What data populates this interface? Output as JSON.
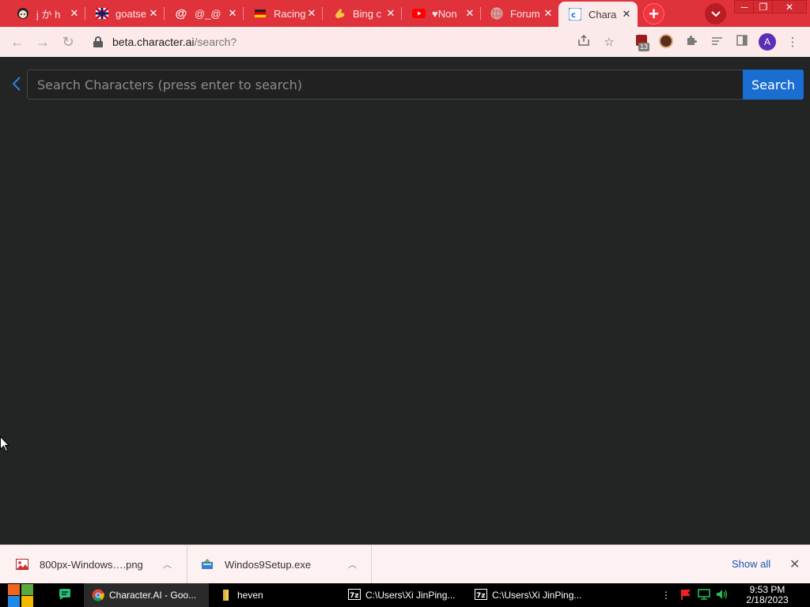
{
  "browser": {
    "tabs": [
      {
        "title": "j か h",
        "icon": "anime-avatar-icon"
      },
      {
        "title": "goatse",
        "icon": "flag-icon"
      },
      {
        "title": "@_@",
        "icon": "at-sign-icon"
      },
      {
        "title": "Racing",
        "icon": "flag-icon"
      },
      {
        "title": "Bing c",
        "icon": "hand-icon"
      },
      {
        "title": "♥Non",
        "icon": "youtube-icon"
      },
      {
        "title": "Forum",
        "icon": "globe-icon"
      },
      {
        "title": "Chara",
        "icon": "character-ai-icon",
        "active": true
      }
    ],
    "new_tab_label": "+",
    "address_bar": {
      "host": "beta.character.ai",
      "path": "/search?"
    },
    "extension_badge_count": "13",
    "profile_initial": "A",
    "colors": {
      "frame": "#e0323a",
      "toolbar": "#fce9ea"
    }
  },
  "page": {
    "search": {
      "placeholder": "Search Characters (press enter to search)",
      "value": "",
      "button_label": "Search"
    },
    "colors": {
      "background": "#232424",
      "accent": "#1a6ed1"
    }
  },
  "downloads": {
    "items": [
      {
        "filename": "800px-Windows….png",
        "icon": "image-file-icon"
      },
      {
        "filename": "Windos9Setup.exe",
        "icon": "installer-icon"
      }
    ],
    "show_all_label": "Show all"
  },
  "taskbar": {
    "apps": [
      {
        "label": "Character.AI - Goo...",
        "icon": "chrome-icon",
        "active": true
      },
      {
        "label": "heven",
        "icon": "folder-icon"
      },
      {
        "label": "C:\\Users\\Xi JinPing...",
        "icon": "7zip-icon"
      },
      {
        "label": "C:\\Users\\Xi JinPing...",
        "icon": "7zip-icon"
      }
    ],
    "clock": {
      "time": "9:53 PM",
      "date": "2/18/2023"
    }
  }
}
